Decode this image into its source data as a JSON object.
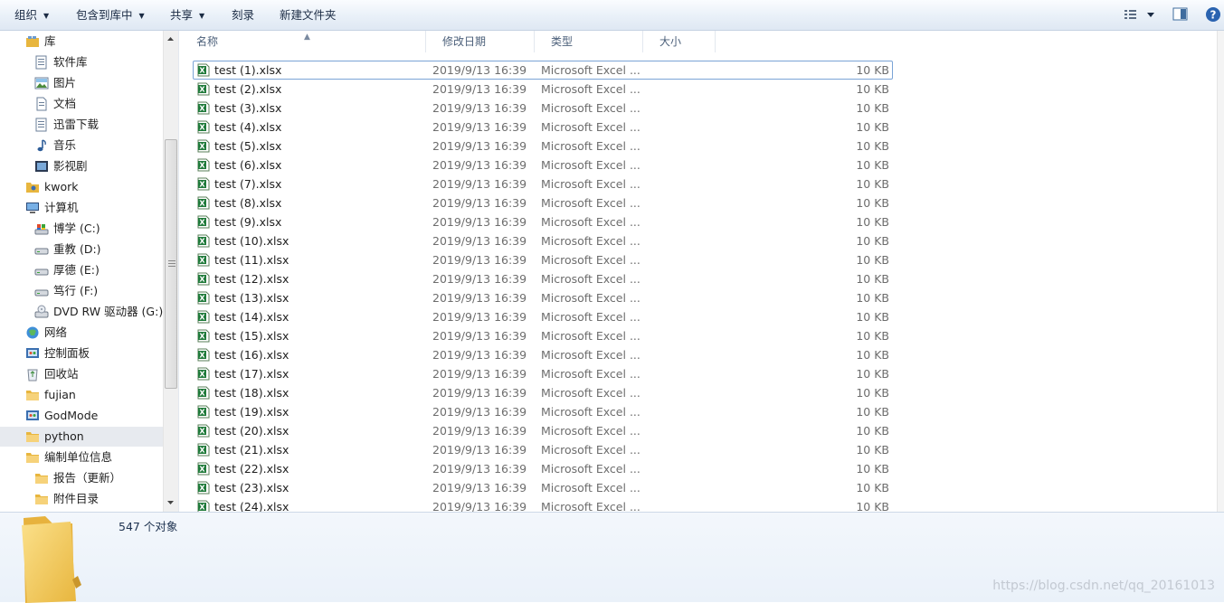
{
  "toolbar": {
    "organize": "组织",
    "include_in_library": "包含到库中",
    "share": "共享",
    "burn": "刻录",
    "new_folder": "新建文件夹"
  },
  "nav": {
    "items": [
      {
        "label": "库",
        "level": 0,
        "icon": "library-icon"
      },
      {
        "label": "软件库",
        "level": 1,
        "icon": "document-library-icon"
      },
      {
        "label": "图片",
        "level": 1,
        "icon": "picture-library-icon"
      },
      {
        "label": "文档",
        "level": 1,
        "icon": "document-icon"
      },
      {
        "label": "迅雷下载",
        "level": 1,
        "icon": "document-library-icon"
      },
      {
        "label": "音乐",
        "level": 1,
        "icon": "music-note-icon"
      },
      {
        "label": "影视剧",
        "level": 1,
        "icon": "video-library-icon"
      },
      {
        "label": "kwork",
        "level": 0,
        "icon": "user-folder-icon"
      },
      {
        "label": "计算机",
        "level": 0,
        "icon": "computer-icon"
      },
      {
        "label": "博学 (C:)",
        "level": 1,
        "icon": "system-drive-icon"
      },
      {
        "label": "重教 (D:)",
        "level": 1,
        "icon": "drive-icon"
      },
      {
        "label": "厚德 (E:)",
        "level": 1,
        "icon": "drive-icon"
      },
      {
        "label": "笃行 (F:)",
        "level": 1,
        "icon": "drive-icon"
      },
      {
        "label": "DVD RW 驱动器 (G:)",
        "level": 1,
        "icon": "dvd-drive-icon"
      },
      {
        "label": "网络",
        "level": 0,
        "icon": "network-icon"
      },
      {
        "label": "控制面板",
        "level": 0,
        "icon": "control-panel-icon"
      },
      {
        "label": "回收站",
        "level": 0,
        "icon": "recycle-bin-icon"
      },
      {
        "label": "fujian",
        "level": 0,
        "icon": "folder-icon"
      },
      {
        "label": "GodMode",
        "level": 0,
        "icon": "control-panel-icon"
      },
      {
        "label": "python",
        "level": 0,
        "icon": "folder-icon",
        "selected": true
      },
      {
        "label": "编制单位信息",
        "level": 0,
        "icon": "folder-icon"
      },
      {
        "label": "报告（更新）",
        "level": 1,
        "icon": "folder-icon"
      },
      {
        "label": "附件目录",
        "level": 1,
        "icon": "folder-icon"
      }
    ]
  },
  "columns": {
    "name": "名称",
    "date": "修改日期",
    "type": "类型",
    "size": "大小"
  },
  "files": [
    {
      "name": "test (1).xlsx",
      "date": "2019/9/13 16:39",
      "type": "Microsoft Excel ...",
      "size": "10 KB"
    },
    {
      "name": "test (2).xlsx",
      "date": "2019/9/13 16:39",
      "type": "Microsoft Excel ...",
      "size": "10 KB"
    },
    {
      "name": "test (3).xlsx",
      "date": "2019/9/13 16:39",
      "type": "Microsoft Excel ...",
      "size": "10 KB"
    },
    {
      "name": "test (4).xlsx",
      "date": "2019/9/13 16:39",
      "type": "Microsoft Excel ...",
      "size": "10 KB"
    },
    {
      "name": "test (5).xlsx",
      "date": "2019/9/13 16:39",
      "type": "Microsoft Excel ...",
      "size": "10 KB"
    },
    {
      "name": "test (6).xlsx",
      "date": "2019/9/13 16:39",
      "type": "Microsoft Excel ...",
      "size": "10 KB"
    },
    {
      "name": "test (7).xlsx",
      "date": "2019/9/13 16:39",
      "type": "Microsoft Excel ...",
      "size": "10 KB"
    },
    {
      "name": "test (8).xlsx",
      "date": "2019/9/13 16:39",
      "type": "Microsoft Excel ...",
      "size": "10 KB"
    },
    {
      "name": "test (9).xlsx",
      "date": "2019/9/13 16:39",
      "type": "Microsoft Excel ...",
      "size": "10 KB"
    },
    {
      "name": "test (10).xlsx",
      "date": "2019/9/13 16:39",
      "type": "Microsoft Excel ...",
      "size": "10 KB"
    },
    {
      "name": "test (11).xlsx",
      "date": "2019/9/13 16:39",
      "type": "Microsoft Excel ...",
      "size": "10 KB"
    },
    {
      "name": "test (12).xlsx",
      "date": "2019/9/13 16:39",
      "type": "Microsoft Excel ...",
      "size": "10 KB"
    },
    {
      "name": "test (13).xlsx",
      "date": "2019/9/13 16:39",
      "type": "Microsoft Excel ...",
      "size": "10 KB"
    },
    {
      "name": "test (14).xlsx",
      "date": "2019/9/13 16:39",
      "type": "Microsoft Excel ...",
      "size": "10 KB"
    },
    {
      "name": "test (15).xlsx",
      "date": "2019/9/13 16:39",
      "type": "Microsoft Excel ...",
      "size": "10 KB"
    },
    {
      "name": "test (16).xlsx",
      "date": "2019/9/13 16:39",
      "type": "Microsoft Excel ...",
      "size": "10 KB"
    },
    {
      "name": "test (17).xlsx",
      "date": "2019/9/13 16:39",
      "type": "Microsoft Excel ...",
      "size": "10 KB"
    },
    {
      "name": "test (18).xlsx",
      "date": "2019/9/13 16:39",
      "type": "Microsoft Excel ...",
      "size": "10 KB"
    },
    {
      "name": "test (19).xlsx",
      "date": "2019/9/13 16:39",
      "type": "Microsoft Excel ...",
      "size": "10 KB"
    },
    {
      "name": "test (20).xlsx",
      "date": "2019/9/13 16:39",
      "type": "Microsoft Excel ...",
      "size": "10 KB"
    },
    {
      "name": "test (21).xlsx",
      "date": "2019/9/13 16:39",
      "type": "Microsoft Excel ...",
      "size": "10 KB"
    },
    {
      "name": "test (22).xlsx",
      "date": "2019/9/13 16:39",
      "type": "Microsoft Excel ...",
      "size": "10 KB"
    },
    {
      "name": "test (23).xlsx",
      "date": "2019/9/13 16:39",
      "type": "Microsoft Excel ...",
      "size": "10 KB"
    },
    {
      "name": "test (24).xlsx",
      "date": "2019/9/13 16:39",
      "type": "Microsoft Excel ...",
      "size": "10 KB"
    }
  ],
  "details": {
    "count": "547 个对象"
  },
  "watermark": "https://blog.csdn.net/qq_20161013"
}
